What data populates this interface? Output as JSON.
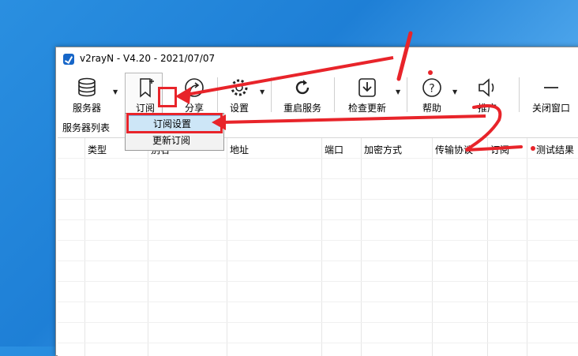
{
  "window": {
    "title": "v2rayN - V4.20 - 2021/07/07"
  },
  "toolbar": {
    "servers": "服务器",
    "subscribe": "订阅",
    "share": "分享",
    "settings": "设置",
    "restart": "重启服务",
    "check_update": "检查更新",
    "help": "帮助",
    "promote": "推广",
    "close_window": "关闭窗口"
  },
  "server_list_label": "服务器列表",
  "columns": [
    "类型",
    "别名",
    "地址",
    "端口",
    "加密方式",
    "传输协议",
    "订阅",
    "测试结果"
  ],
  "menu": {
    "items": [
      "订阅设置",
      "更新订阅"
    ]
  },
  "annotations": {
    "step1": "1",
    "step2": "2"
  },
  "colors": {
    "accent_red": "#e8242a",
    "desktop_blue": "#1e7fd6",
    "menu_highlight": "#cde6f7"
  },
  "icons": [
    "app-icon",
    "database-icon",
    "bookmark-plus-icon",
    "share-icon",
    "gear-icon",
    "refresh-icon",
    "download-icon",
    "help-icon",
    "speaker-icon",
    "minus-icon"
  ]
}
